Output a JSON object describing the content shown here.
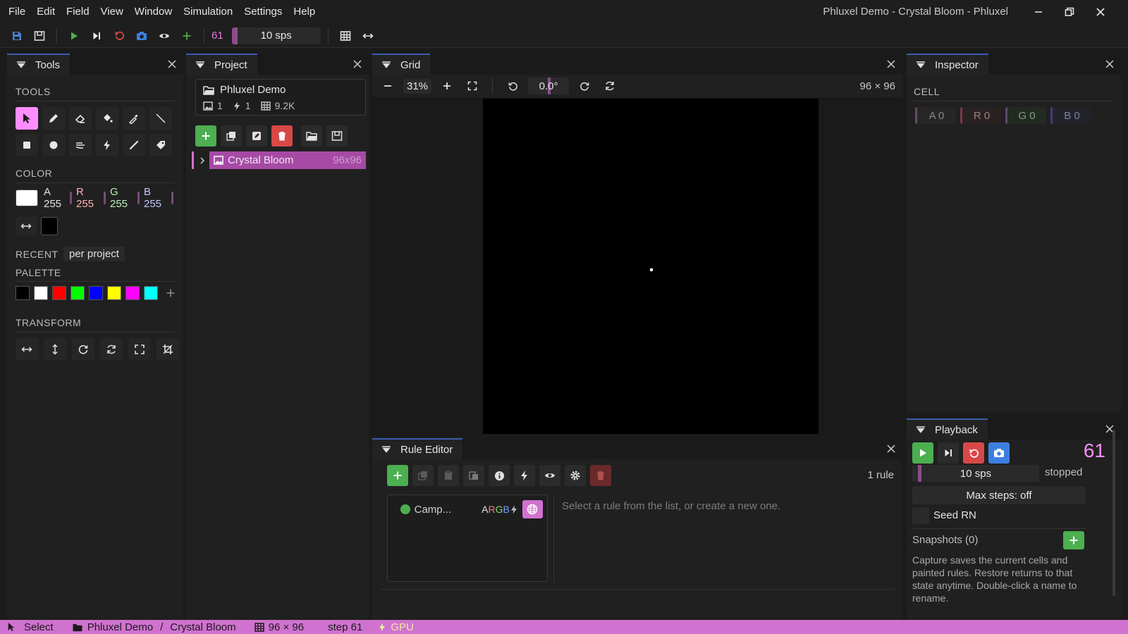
{
  "menu": [
    "File",
    "Edit",
    "Field",
    "View",
    "Window",
    "Simulation",
    "Settings",
    "Help"
  ],
  "window_title": "Phluxel Demo - Crystal Bloom - Phluxel",
  "toolbar": {
    "step_count": "61",
    "sps": "10 sps"
  },
  "tools_panel": {
    "tab": "Tools",
    "tools_label": "TOOLS",
    "color_label": "COLOR",
    "channels": {
      "a": "A 255",
      "r": "R 255",
      "g": "G 255",
      "b": "B 255"
    },
    "recent_label": "RECENT",
    "recent_scope": "per project",
    "palette_label": "PALETTE",
    "palette_colors": [
      "#000000",
      "#ffffff",
      "#ff0000",
      "#00ff00",
      "#0000ff",
      "#ffff00",
      "#ff00ff",
      "#00ffff"
    ],
    "transform_label": "TRANSFORM"
  },
  "project_panel": {
    "tab": "Project",
    "project_name": "Phluxel Demo",
    "images_count": "1",
    "rules_count": "1",
    "cells_count": "9.2K",
    "tree_item": {
      "name": "Crystal Bloom",
      "size": "96x96"
    }
  },
  "grid_panel": {
    "tab": "Grid",
    "zoom": "31%",
    "rotation": "0.0°",
    "dimensions": "96 × 96"
  },
  "inspector_panel": {
    "tab": "Inspector",
    "cell_label": "CELL",
    "channels": {
      "a": "A 0",
      "r": "R 0",
      "g": "G 0",
      "b": "B 0"
    }
  },
  "rule_editor": {
    "tab": "Rule Editor",
    "rule_count": "1 rule",
    "rule_item": {
      "name": "Camp...",
      "channels_a": "A",
      "channels_r": "R",
      "channels_g": "G",
      "channels_b": "B"
    },
    "placeholder": "Select a rule from the list, or create a new one."
  },
  "playback": {
    "tab": "Playback",
    "step": "61",
    "sps": "10 sps",
    "state": "stopped",
    "max_steps": "Max steps: off",
    "seed_label": "Seed RN",
    "snapshots_label": "Snapshots (0)",
    "help_text": "Capture saves the current cells and painted rules. Restore returns to that state anytime. Double-click a name to rename."
  },
  "status_bar": {
    "tool": "Select",
    "project": "Phluxel Demo",
    "separator": "/",
    "image": "Crystal Bloom",
    "dims": "96 × 96",
    "step": "step 61",
    "backend": "GPU"
  }
}
